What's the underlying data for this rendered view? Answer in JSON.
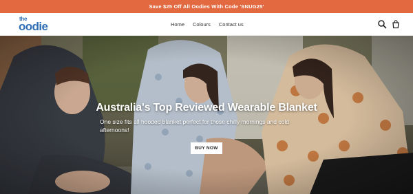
{
  "announcement": {
    "text": "Save $25 Off All Oodies With Code 'SNUG25'"
  },
  "logo": {
    "top": "the",
    "main": "oodie"
  },
  "nav": {
    "items": [
      "Home",
      "Colours",
      "Contact us"
    ]
  },
  "icons": {
    "search": "search-icon",
    "cart": "cart-icon"
  },
  "hero": {
    "title": "Australia's Top Reviewed Wearable Blanket",
    "subtitle": "One size fits all hooded blanket perfect for those chilly mornings and cold afternoons!",
    "cta": "BUY NOW"
  },
  "colors": {
    "announcement_bg": "#e36a40",
    "logo": "#2f6fb6"
  }
}
